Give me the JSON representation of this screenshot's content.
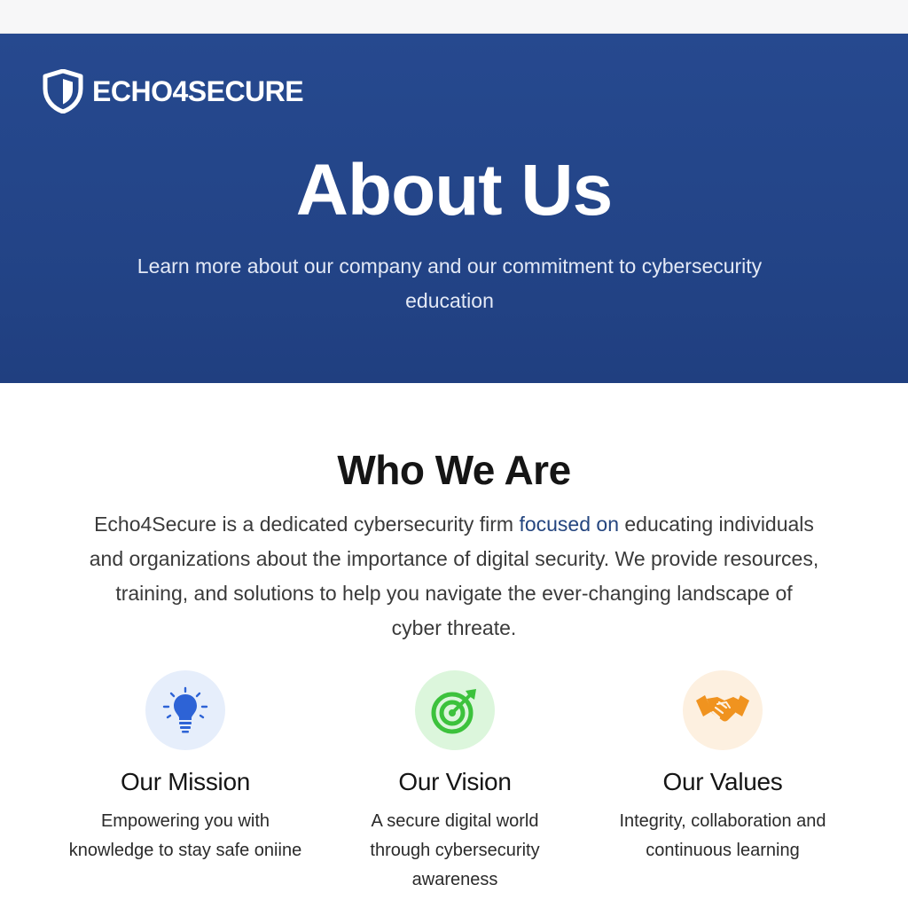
{
  "brand": {
    "name": "ECHO4SECURE",
    "logo_icon": "shield-icon"
  },
  "hero": {
    "title": "About Us",
    "subtitle": "Learn more about our company and our commitment to cybersecurity education",
    "background_color": "#234487"
  },
  "who_we_are": {
    "title": "Who We Are",
    "body_before": "Echo4Secure is a dedicated cybersecurity firm ",
    "body_accent": "focused on",
    "body_after": " educating individuals and organizations about the importance of digital security. We provide resources, training, and solutions to help you navigate the ever-changing landscape of cyber threate."
  },
  "cards": [
    {
      "icon": "lightbulb-icon",
      "icon_color": "#2d63d6",
      "circle_color": "#e6eefb",
      "title": "Our Mission",
      "text": "Empowering you with knowledge to stay safe oniine"
    },
    {
      "icon": "target-icon",
      "icon_color": "#3cc23c",
      "circle_color": "#dcf6dc",
      "title": "Our Vision",
      "text": "A secure digital world through cybersecurity awareness"
    },
    {
      "icon": "handshake-icon",
      "icon_color": "#f0931f",
      "circle_color": "#fdf0e0",
      "title": "Our Values",
      "text": "Integrity, collaboration and continuous learning"
    }
  ]
}
